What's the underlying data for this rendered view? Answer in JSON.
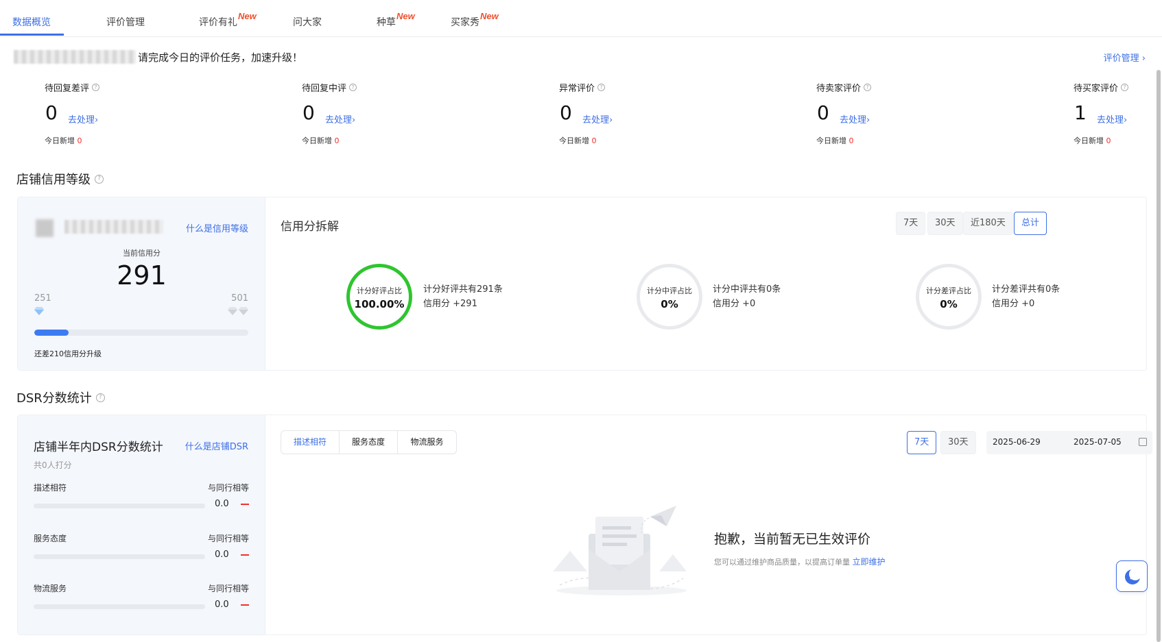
{
  "tabs": [
    {
      "label": "数据概览",
      "badge": ""
    },
    {
      "label": "评价管理",
      "badge": ""
    },
    {
      "label": "评价有礼",
      "badge": "New"
    },
    {
      "label": "问大家",
      "badge": ""
    },
    {
      "label": "种草",
      "badge": "New"
    },
    {
      "label": "买家秀",
      "badge": "New"
    }
  ],
  "notice": {
    "text": "请完成今日的评价任务，加速升级！",
    "link": "评价管理 ›"
  },
  "stats": [
    {
      "label": "待回复差评",
      "value": "0",
      "action": "去处理›",
      "today_label": "今日新增",
      "today_value": "0"
    },
    {
      "label": "待回复中评",
      "value": "0",
      "action": "去处理›",
      "today_label": "今日新增",
      "today_value": "0"
    },
    {
      "label": "异常评价",
      "value": "0",
      "action": "去处理›",
      "today_label": "今日新增",
      "today_value": "0"
    },
    {
      "label": "待卖家评价",
      "value": "0",
      "action": "去处理›",
      "today_label": "今日新增",
      "today_value": "0"
    },
    {
      "label": "待买家评价",
      "value": "1",
      "action": "去处理›",
      "today_label": "今日新增",
      "today_value": "0"
    }
  ],
  "credit": {
    "section_title": "店铺信用等级",
    "what_link": "什么是信用等级",
    "current_label": "当前信用分",
    "current_score": "291",
    "level_min": "251",
    "level_max": "501",
    "progress": 0.16,
    "upgrade_text": "还差210信用分升级",
    "breakdown_title": "信用分拆解",
    "ranges": [
      "7天",
      "30天",
      "近180天",
      "总计"
    ],
    "active_range": "总计",
    "rings": [
      {
        "label": "计分好评占比",
        "value": "100.00%",
        "line1": "计分好评共有291条",
        "line2": "信用分 +291",
        "color": "#2fc52f"
      },
      {
        "label": "计分中评占比",
        "value": "0%",
        "line1": "计分中评共有0条",
        "line2": "信用分 +0",
        "color": "#e9eaed"
      },
      {
        "label": "计分差评占比",
        "value": "0%",
        "line1": "计分差评共有0条",
        "line2": "信用分 +0",
        "color": "#e9eaed"
      }
    ]
  },
  "dsr": {
    "section_title": "DSR分数统计",
    "title": "店铺半年内DSR分数统计",
    "what_link": "什么是店铺DSR",
    "count_text": "共0人打分",
    "rows": [
      {
        "name": "描述相符",
        "compare": "与同行相等",
        "score": "0.0"
      },
      {
        "name": "服务态度",
        "compare": "与同行相等",
        "score": "0.0"
      },
      {
        "name": "物流服务",
        "compare": "与同行相等",
        "score": "0.0"
      }
    ],
    "segments": [
      "描述相符",
      "服务态度",
      "物流服务"
    ],
    "active_segment": "描述相符",
    "ranges": [
      "7天",
      "30天"
    ],
    "active_range": "7天",
    "date_start": "2025-06-29",
    "date_end": "2025-07-05",
    "empty_title": "抱歉，当前暂无已生效评价",
    "empty_desc": "您可以通过维护商品质量，以提高订单量",
    "empty_link": "立即维护"
  },
  "colors": {
    "accent": "#3d6fe6",
    "new_badge": "#f0502d",
    "danger": "#f0302d",
    "good": "#2fc52f"
  },
  "icons": [
    "help-icon",
    "diamond-icon",
    "calendar-icon",
    "paper-plane-icon",
    "envelope-icon",
    "moon-icon"
  ]
}
